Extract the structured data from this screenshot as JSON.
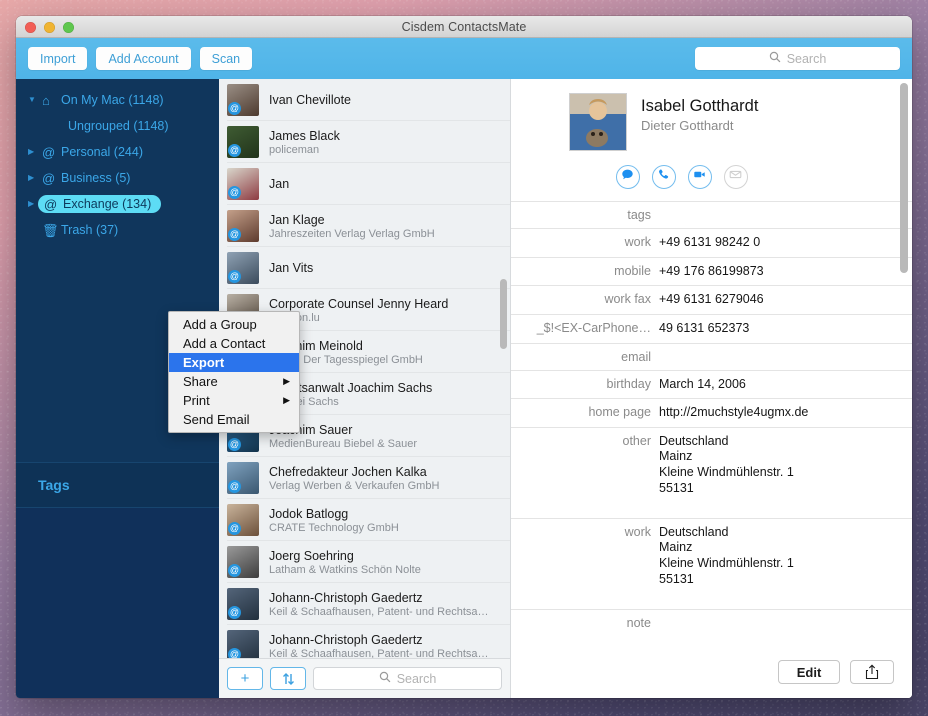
{
  "window": {
    "title": "Cisdem ContactsMate"
  },
  "toolbar": {
    "import_label": "Import",
    "add_account_label": "Add Account",
    "scan_label": "Scan",
    "search_placeholder": "Search",
    "search_value": ""
  },
  "sidebar": {
    "sources": [
      {
        "label": "On My Mac (1148)",
        "icon": "house-icon",
        "icon_glyph": "⌂",
        "disclosure": "open",
        "indent": false,
        "selected": false
      },
      {
        "label": "Ungrouped (1148)",
        "icon": "",
        "icon_glyph": "",
        "disclosure": "blank",
        "indent": true,
        "selected": false
      },
      {
        "label": "Personal (244)",
        "icon": "at-icon",
        "icon_glyph": "@",
        "disclosure": "closed",
        "indent": false,
        "selected": false
      },
      {
        "label": "Business (5)",
        "icon": "at-icon",
        "icon_glyph": "@",
        "disclosure": "closed",
        "indent": false,
        "selected": false
      },
      {
        "label": "Exchange (134)",
        "icon": "at-icon",
        "icon_glyph": "@",
        "disclosure": "closed",
        "indent": false,
        "selected": true
      },
      {
        "label": "Trash (37)",
        "icon": "trash-icon",
        "icon_glyph": "🗑",
        "disclosure": "blank",
        "indent": false,
        "selected": false
      }
    ],
    "tags_label": "Tags"
  },
  "context_menu": {
    "items": [
      {
        "label": "Add a Group",
        "highlighted": false,
        "submenu": false
      },
      {
        "label": "Add a Contact",
        "highlighted": false,
        "submenu": false
      },
      {
        "label": "Export",
        "highlighted": true,
        "submenu": false
      },
      {
        "label": "Share",
        "highlighted": false,
        "submenu": true
      },
      {
        "label": "Print",
        "highlighted": false,
        "submenu": true
      },
      {
        "label": "Send Email",
        "highlighted": false,
        "submenu": false
      }
    ],
    "submenu_arrow": "▶"
  },
  "contact_list": {
    "badge_glyph": "@",
    "rows": [
      {
        "name": "Ivan Chevillote",
        "org": "",
        "avatar_colors": [
          "#9a8f86",
          "#4d3a2e"
        ]
      },
      {
        "name": "James Black",
        "org": "policeman",
        "avatar_colors": [
          "#3f5c33",
          "#21331a"
        ]
      },
      {
        "name": "Jan",
        "org": "",
        "avatar_colors": [
          "#d9d7cc",
          "#8e3b42"
        ]
      },
      {
        "name": "Jan Klage",
        "org": "Jahreszeiten Verlag Verlag GmbH",
        "avatar_colors": [
          "#c4a08a",
          "#5e3b2e"
        ]
      },
      {
        "name": "Jan Vits",
        "org": "",
        "avatar_colors": [
          "#8fa2b4",
          "#3b4b5c"
        ]
      },
      {
        "name": "Corporate Counsel Jenny Heard",
        "org": "amazon.lu",
        "avatar_colors": [
          "#b8b0a4",
          "#54483d"
        ]
      },
      {
        "name": "Joachim Meinold",
        "org": "Verlag Der Tagesspiegel GmbH",
        "avatar_colors": [
          "#7d8d9c",
          "#2f3b46"
        ]
      },
      {
        "name": "Rechtsanwalt Joachim Sachs",
        "org": "Kanzlei Sachs",
        "avatar_colors": [
          "#2b3a4a",
          "#0f1722"
        ]
      },
      {
        "name": "Joachim Sauer",
        "org": "MedienBureau Biebel & Sauer",
        "avatar_colors": [
          "#2f6d9e",
          "#13324a"
        ]
      },
      {
        "name": "Chefredakteur Jochen Kalka",
        "org": "Verlag Werben & Verkaufen GmbH",
        "avatar_colors": [
          "#7fa2bf",
          "#3a5770"
        ]
      },
      {
        "name": "Jodok Batlogg",
        "org": "CRATE Technology GmbH",
        "avatar_colors": [
          "#c9b49c",
          "#6c503a"
        ]
      },
      {
        "name": "Joerg Soehring",
        "org": "Latham & Watkins Schön Nolte",
        "avatar_colors": [
          "#9a9a9a",
          "#3d3d3d"
        ]
      },
      {
        "name": "Johann-Christoph Gaedertz",
        "org": "Keil & Schaafhausen, Patent- und Rechtsa…",
        "avatar_colors": [
          "#54657a",
          "#22303e"
        ]
      },
      {
        "name": "Johann-Christoph Gaedertz",
        "org": "Keil & Schaafhausen, Patent- und Rechtsa…",
        "avatar_colors": [
          "#54657a",
          "#22303e"
        ]
      }
    ],
    "add_button_glyph": "+",
    "sort_button_glyph": "↑↓",
    "search_placeholder": "Search",
    "search_value": ""
  },
  "detail": {
    "name": "Isabel Gotthardt",
    "subtitle": "Dieter Gotthardt",
    "actions": [
      {
        "name": "message-icon",
        "enabled": true
      },
      {
        "name": "phone-icon",
        "enabled": true
      },
      {
        "name": "video-icon",
        "enabled": true
      },
      {
        "name": "email-icon",
        "enabled": false
      }
    ],
    "fields": [
      {
        "label": "tags",
        "value": ""
      },
      {
        "label": "work",
        "value": "+49 6131 98242 0"
      },
      {
        "label": "mobile",
        "value": "+49 176 86199873"
      },
      {
        "label": "work fax",
        "value": "+49 6131 6279046"
      },
      {
        "label": "_$!<EX-CarPhone…",
        "value": "49 6131 652373"
      },
      {
        "label": "email",
        "value": ""
      },
      {
        "label": "birthday",
        "value": "March 14, 2006"
      },
      {
        "label": "home page",
        "value": "http://2muchstyle4ugmx.de"
      },
      {
        "label": "other",
        "value": "Deutschland\nMainz\nKleine Windmühlenstr. 1\n55131",
        "tall": true
      },
      {
        "label": "work",
        "value": "Deutschland\nMainz\nKleine Windmühlenstr. 1\n55131",
        "tall": true
      },
      {
        "label": "note",
        "value": ""
      }
    ],
    "edit_label": "Edit",
    "share_icon": "share-icon"
  },
  "colors": {
    "toolbar_blue": "#4fb4e8",
    "sidebar_navy": "#10365c",
    "accent_cyan": "#5ddcf5",
    "menu_highlight": "#2b74ec",
    "link_blue": "#3ba7e8"
  }
}
